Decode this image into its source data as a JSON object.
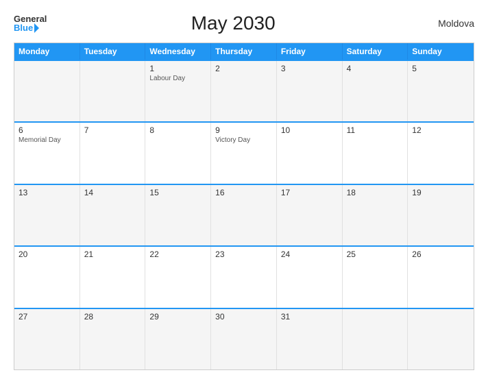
{
  "header": {
    "logo_general": "General",
    "logo_blue": "Blue",
    "title": "May 2030",
    "country": "Moldova"
  },
  "calendar": {
    "weekdays": [
      "Monday",
      "Tuesday",
      "Wednesday",
      "Thursday",
      "Friday",
      "Saturday",
      "Sunday"
    ],
    "weeks": [
      [
        {
          "day": "",
          "event": ""
        },
        {
          "day": "",
          "event": ""
        },
        {
          "day": "1",
          "event": "Labour Day"
        },
        {
          "day": "2",
          "event": ""
        },
        {
          "day": "3",
          "event": ""
        },
        {
          "day": "4",
          "event": ""
        },
        {
          "day": "5",
          "event": ""
        }
      ],
      [
        {
          "day": "6",
          "event": "Memorial Day"
        },
        {
          "day": "7",
          "event": ""
        },
        {
          "day": "8",
          "event": ""
        },
        {
          "day": "9",
          "event": "Victory Day"
        },
        {
          "day": "10",
          "event": ""
        },
        {
          "day": "11",
          "event": ""
        },
        {
          "day": "12",
          "event": ""
        }
      ],
      [
        {
          "day": "13",
          "event": ""
        },
        {
          "day": "14",
          "event": ""
        },
        {
          "day": "15",
          "event": ""
        },
        {
          "day": "16",
          "event": ""
        },
        {
          "day": "17",
          "event": ""
        },
        {
          "day": "18",
          "event": ""
        },
        {
          "day": "19",
          "event": ""
        }
      ],
      [
        {
          "day": "20",
          "event": ""
        },
        {
          "day": "21",
          "event": ""
        },
        {
          "day": "22",
          "event": ""
        },
        {
          "day": "23",
          "event": ""
        },
        {
          "day": "24",
          "event": ""
        },
        {
          "day": "25",
          "event": ""
        },
        {
          "day": "26",
          "event": ""
        }
      ],
      [
        {
          "day": "27",
          "event": ""
        },
        {
          "day": "28",
          "event": ""
        },
        {
          "day": "29",
          "event": ""
        },
        {
          "day": "30",
          "event": ""
        },
        {
          "day": "31",
          "event": ""
        },
        {
          "day": "",
          "event": ""
        },
        {
          "day": "",
          "event": ""
        }
      ]
    ]
  }
}
